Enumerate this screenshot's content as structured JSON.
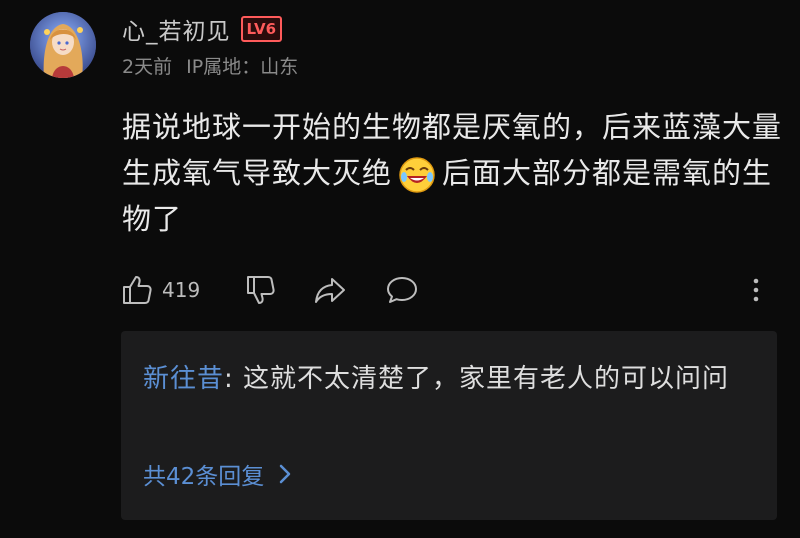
{
  "comment": {
    "username": "心_若初见",
    "level_badge": "LV6",
    "time": "2天前",
    "ip_location": "IP属地：山东",
    "content_part1": "据说地球一开始的生物都是厌氧的，后来蓝藻大量生成氧气导致大灭绝",
    "content_emoji": "laughing-cry-emoji",
    "content_part2": "后面大部分都是需氧的生物了",
    "like_count": "419",
    "icons": {
      "like": "thumbs-up-icon",
      "dislike": "thumbs-down-icon",
      "share": "share-arrow-icon",
      "reply": "speech-bubble-icon",
      "more": "more-vertical-icon"
    },
    "colors": {
      "background": "#0b0b0b",
      "level_badge": "#ff5b5b",
      "link_blue": "#5b8fd4",
      "reply_box": "#1c1c1d"
    }
  },
  "reply_preview": {
    "author": "新往昔",
    "separator": ": ",
    "text": "这就不太清楚了，家里有老人的可以问问",
    "more_label": "共42条回复",
    "more_icon": "chevron-right-icon"
  }
}
